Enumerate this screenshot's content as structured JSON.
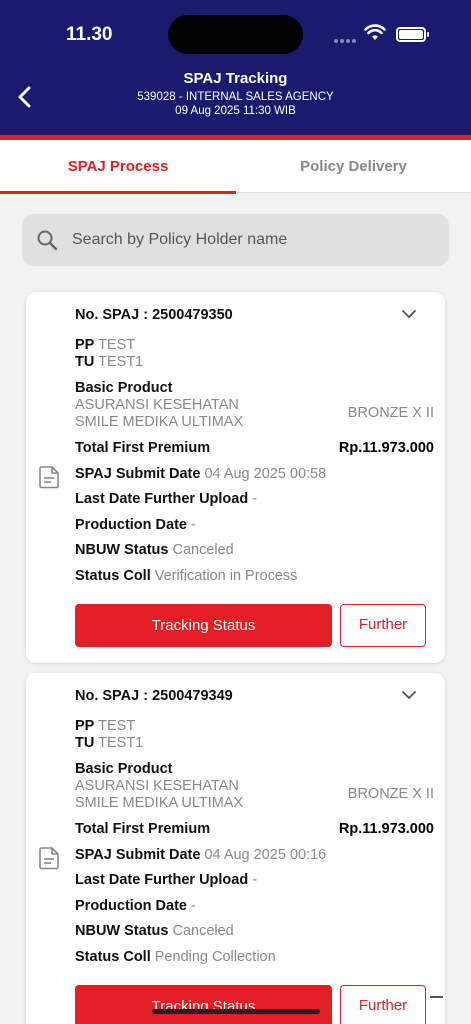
{
  "status_bar": {
    "time": "11.30"
  },
  "header": {
    "title": "SPAJ Tracking",
    "subtitle": "539028 - INTERNAL SALES AGENCY",
    "date": "09 Aug 2025 11:30 WIB"
  },
  "tabs": [
    {
      "label": "SPAJ Process",
      "active": true
    },
    {
      "label": "Policy Delivery",
      "active": false
    }
  ],
  "search": {
    "placeholder": "Search by Policy Holder name"
  },
  "labels": {
    "pp": "PP",
    "tu": "TU",
    "basic_product": "Basic Product",
    "total_first_premium": "Total First Premium",
    "spaj_submit_date": "SPAJ Submit Date",
    "last_date_further_upload": "Last Date Further Upload",
    "production_date": "Production Date",
    "nbuw_status": "NBUW Status",
    "status_coll": "Status Coll",
    "tracking_button": "Tracking Status",
    "further_button": "Further"
  },
  "cards": [
    {
      "spaj_no": "No. SPAJ : 2500479350",
      "pp": "TEST",
      "tu": "TEST1",
      "product_line1": "ASURANSI KESEHATAN",
      "product_line2": "SMILE MEDIKA ULTIMAX",
      "plan": "BRONZE X II",
      "premium": "Rp.11.973.000",
      "submit_date": "04 Aug 2025 00:58",
      "further_upload": "-",
      "production_date": "-",
      "nbuw_status": "Canceled",
      "status_coll": "Verification in Process"
    },
    {
      "spaj_no": "No. SPAJ : 2500479349",
      "pp": "TEST",
      "tu": "TEST1",
      "product_line1": "ASURANSI KESEHATAN",
      "product_line2": "SMILE MEDIKA ULTIMAX",
      "plan": "BRONZE X II",
      "premium": "Rp.11.973.000",
      "submit_date": "04 Aug 2025 00:16",
      "further_upload": "-",
      "production_date": "-",
      "nbuw_status": "Canceled",
      "status_coll": "Pending Collection"
    }
  ],
  "colors": {
    "header_bg": "#1a1a6e",
    "accent": "#e31e24"
  }
}
